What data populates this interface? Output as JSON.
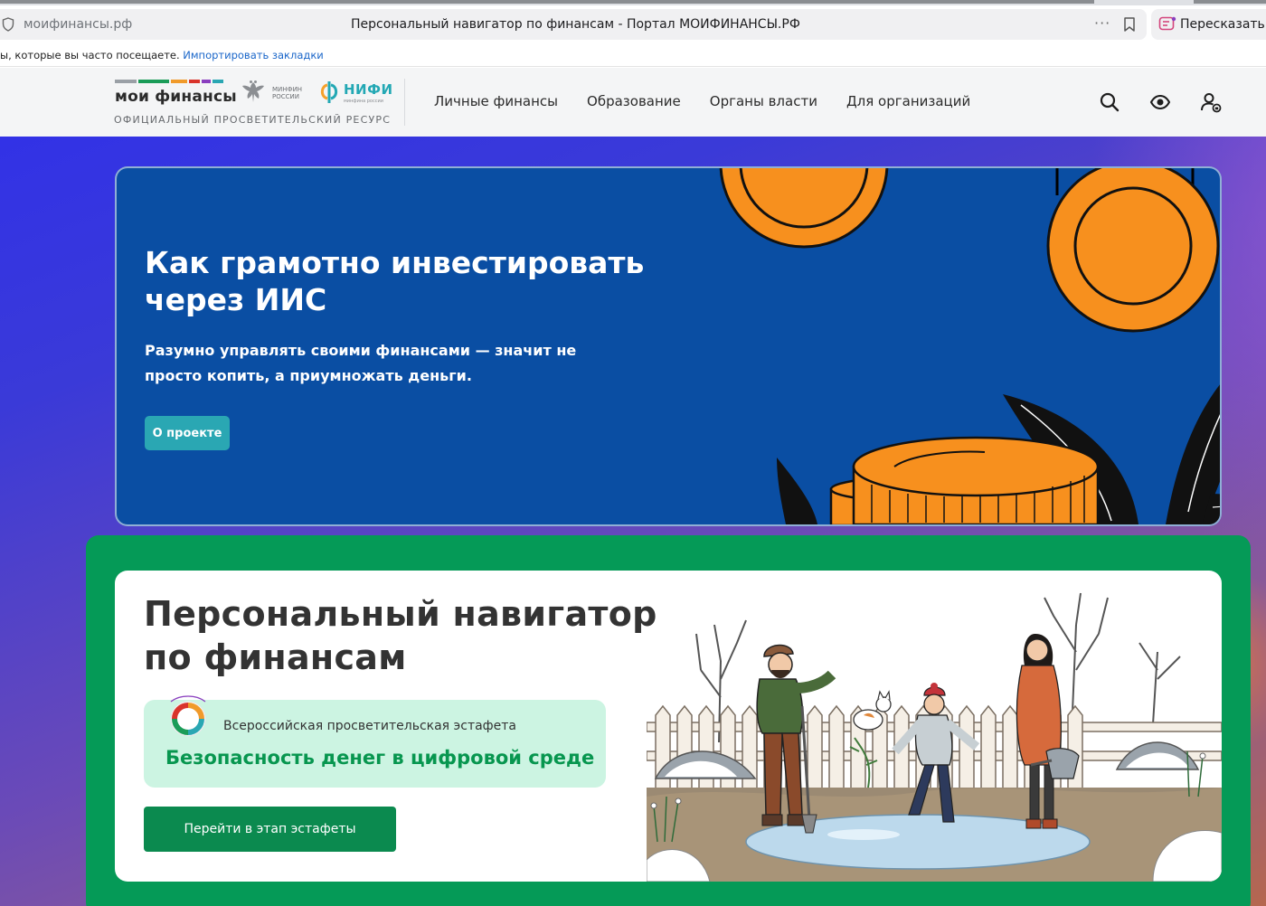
{
  "browser": {
    "domain": "моифинансы.рф",
    "title": "Персональный навигатор по финансам - Портал МОИФИНАНСЫ.РФ",
    "more": "···",
    "retell_label": "Пересказать",
    "bookmarks_text": "ы, которые вы часто посещаете.",
    "bookmarks_link": "Импортировать закладки"
  },
  "header": {
    "logo_text": "мои финансы",
    "logo_sub": "ОФИЦИАЛЬНЫЙ ПРОСВЕТИТЕЛЬСКИЙ РЕСУРС",
    "logo_bar_colors": [
      "#9aa0a6",
      "#1b9c58",
      "#f09a2a",
      "#d9342b",
      "#8a3fbf",
      "#2aa7b3"
    ],
    "minfin_text": "минфин россии",
    "nifi_text": "НИФИ",
    "nifi_sub": "минфина россии",
    "nav": [
      {
        "label": "Личные финансы"
      },
      {
        "label": "Образование"
      },
      {
        "label": "Органы власти"
      },
      {
        "label": "Для организаций"
      }
    ]
  },
  "hero": {
    "title": "Как грамотно инвестировать через ИИС",
    "text": "Разумно управлять своими финансами — значит не просто копить, а приумножать деньги.",
    "button_label": "О проекте",
    "bg_color": "#0a4ea3",
    "coin_color": "#f7901e"
  },
  "navigator": {
    "title_line1": "Персональный навигатор",
    "title_line2": "по финансам",
    "relay_sub": "Всероссийская просветительская эстафета",
    "relay_main": "Безопасность денег в цифровой среде",
    "button_label": "Перейти в этап эстафеты",
    "accent": "#059a57"
  }
}
